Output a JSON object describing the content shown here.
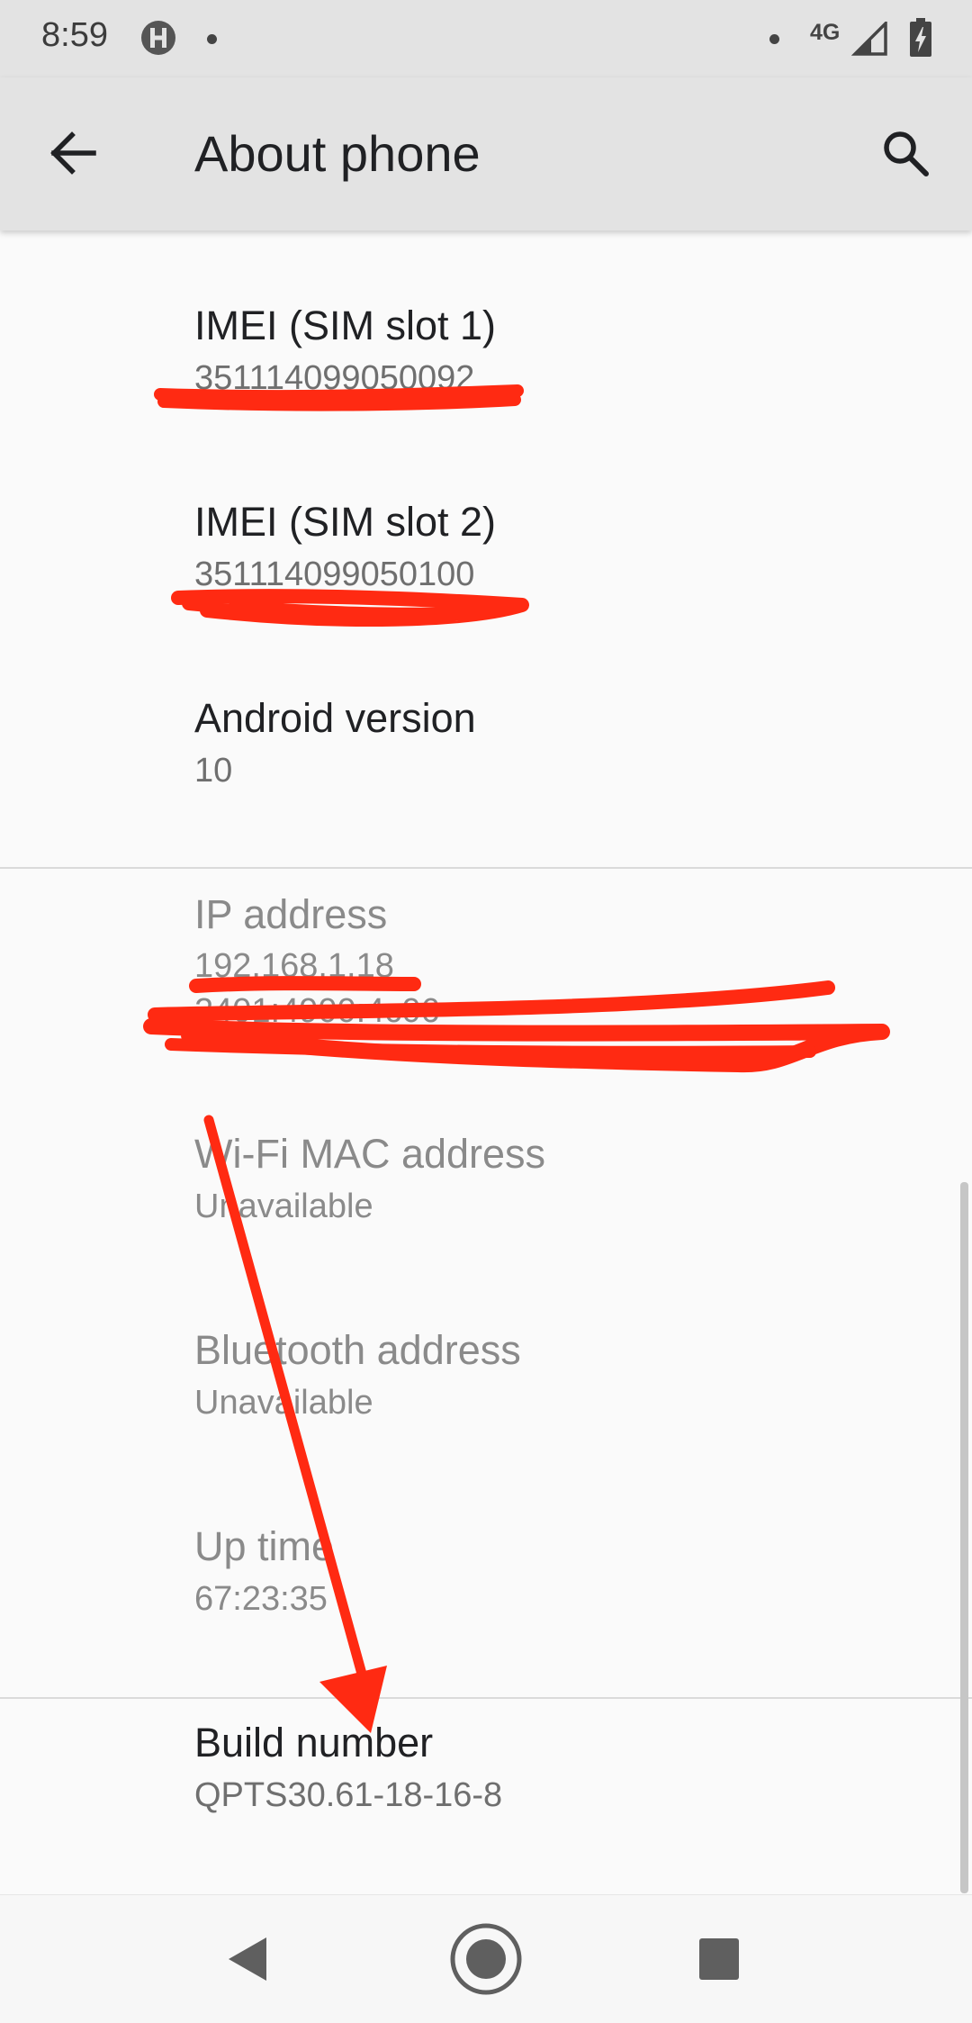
{
  "status_bar": {
    "time": "8:59",
    "network": "4G",
    "notification_icon": "h-circle-icon",
    "signal_icon": "cell-signal-icon",
    "battery_icon": "battery-charging-icon"
  },
  "app_bar": {
    "back_icon": "arrow-back-icon",
    "title": "About phone",
    "search_icon": "search-icon"
  },
  "items": [
    {
      "title": "IMEI (SIM slot 1)",
      "summary": "351114099050092"
    },
    {
      "title": "IMEI (SIM slot 2)",
      "summary": "351114099050100"
    },
    {
      "title": "Android version",
      "summary": "10"
    },
    {
      "title": "IP address",
      "summary_lines": [
        "192.168.1.18",
        "2401:4900:4c06"
      ]
    },
    {
      "title": "Wi-Fi MAC address",
      "summary": "Unavailable"
    },
    {
      "title": "Bluetooth address",
      "summary": "Unavailable"
    },
    {
      "title": "Up time",
      "summary": "67:23:35"
    },
    {
      "title": "Build number",
      "summary": "QPTS30.61-18-16-8"
    }
  ],
  "nav_bar": {
    "back": "nav-back-icon",
    "home": "nav-home-icon",
    "recents": "nav-recents-icon"
  },
  "colors": {
    "status_bar_bg": "#e3e3e3",
    "background": "#fafafa",
    "annotation_red": "#ff2a12"
  }
}
